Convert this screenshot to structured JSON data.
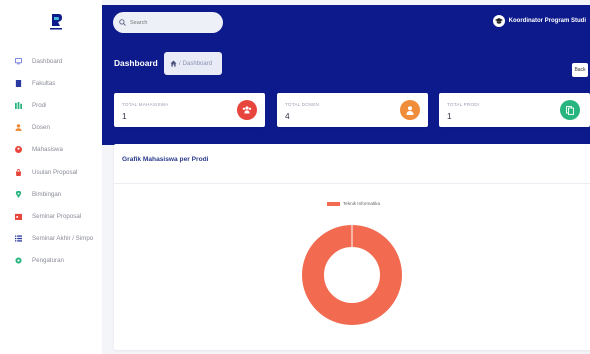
{
  "colors": {
    "banner": "#0d1a8c",
    "accent_red": "#e8453c",
    "accent_orange": "#f08d3a",
    "accent_green": "#28b57f",
    "donut": "#f26a4f"
  },
  "sidebar": {
    "logo_icon": "graduation-logo",
    "items": [
      {
        "label": "Dashboard",
        "icon": "monitor-icon",
        "color": "#6c7ae0"
      },
      {
        "label": "Fakultas",
        "icon": "building-icon",
        "color": "#2a3aa0"
      },
      {
        "label": "Prodi",
        "icon": "books-icon",
        "color": "#28b57f"
      },
      {
        "label": "Dosen",
        "icon": "user-icon",
        "color": "#f08d3a"
      },
      {
        "label": "Mahasiswa",
        "icon": "users-icon",
        "color": "#e8453c"
      },
      {
        "label": "Usulan Proposal",
        "icon": "bag-icon",
        "color": "#e8453c"
      },
      {
        "label": "Bimbingan",
        "icon": "pin-icon",
        "color": "#28b57f"
      },
      {
        "label": "Seminar Proposal",
        "icon": "calendar-icon",
        "color": "#e8453c"
      },
      {
        "label": "Seminar Akhir / Simpo",
        "icon": "list-icon",
        "color": "#2a3aa0"
      },
      {
        "label": "Pengaturan",
        "icon": "gear-icon",
        "color": "#28b57f"
      }
    ]
  },
  "header": {
    "search_placeholder": "Search",
    "user_name": "Koordinator Program Studi",
    "user_icon": "graduation-cap-icon"
  },
  "page": {
    "title": "Dashboard",
    "breadcrumb_sep": "/",
    "breadcrumb_current": "Dashboard",
    "back_label": "Back"
  },
  "stats": [
    {
      "label": "TOTAL MAHASISWA",
      "value": "1",
      "icon": "users-icon",
      "color": "#e8453c"
    },
    {
      "label": "TOTAL DOSEN",
      "value": "4",
      "icon": "user-icon",
      "color": "#f08d3a"
    },
    {
      "label": "TOTAL PRODI",
      "value": "1",
      "icon": "books-icon",
      "color": "#28b57f"
    }
  ],
  "chart": {
    "title": "Grafik Mahasiswa per Prodi"
  },
  "chart_data": {
    "type": "pie",
    "variant": "doughnut",
    "categories": [
      "Teknik Informatika"
    ],
    "values": [
      1
    ],
    "colors": [
      "#f26a4f"
    ],
    "legend_position": "top"
  }
}
